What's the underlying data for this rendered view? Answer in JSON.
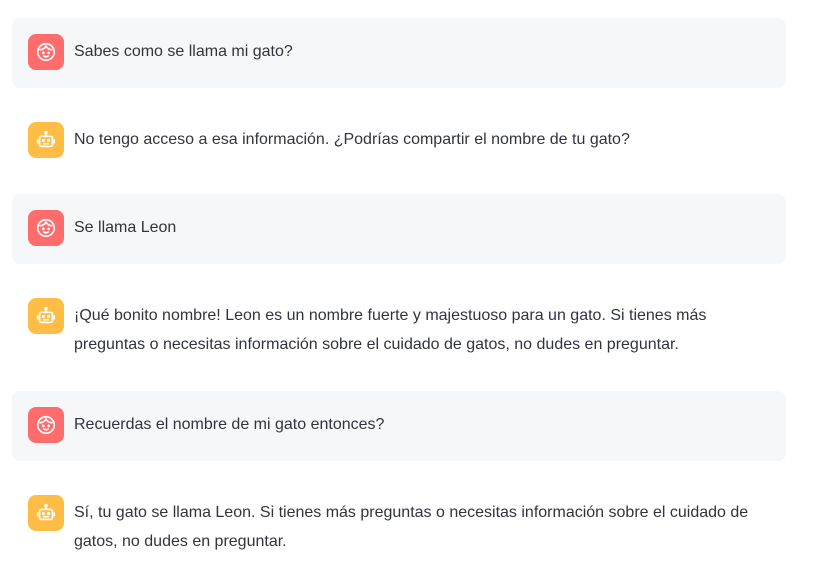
{
  "messages": [
    {
      "role": "user",
      "avatar_icon": "face-icon",
      "avatar_color": "#ff6c6c",
      "text": "Sabes como se llama mi gato?"
    },
    {
      "role": "assistant",
      "avatar_icon": "robot-icon",
      "avatar_color": "#ffbd45",
      "text": "No tengo acceso a esa información. ¿Podrías compartir el nombre de tu gato?"
    },
    {
      "role": "user",
      "avatar_icon": "face-icon",
      "avatar_color": "#ff6c6c",
      "text": "Se llama Leon"
    },
    {
      "role": "assistant",
      "avatar_icon": "robot-icon",
      "avatar_color": "#ffbd45",
      "text": "¡Qué bonito nombre! Leon es un nombre fuerte y majestuoso para un gato. Si tienes más preguntas o necesitas información sobre el cuidado de gatos, no dudes en preguntar."
    },
    {
      "role": "user",
      "avatar_icon": "face-icon",
      "avatar_color": "#ff6c6c",
      "text": "Recuerdas el nombre de mi gato entonces?"
    },
    {
      "role": "assistant",
      "avatar_icon": "robot-icon",
      "avatar_color": "#ffbd45",
      "text": "Sí, tu gato se llama Leon. Si tienes más preguntas o necesitas información sobre el cuidado de gatos, no dudes en preguntar."
    }
  ]
}
